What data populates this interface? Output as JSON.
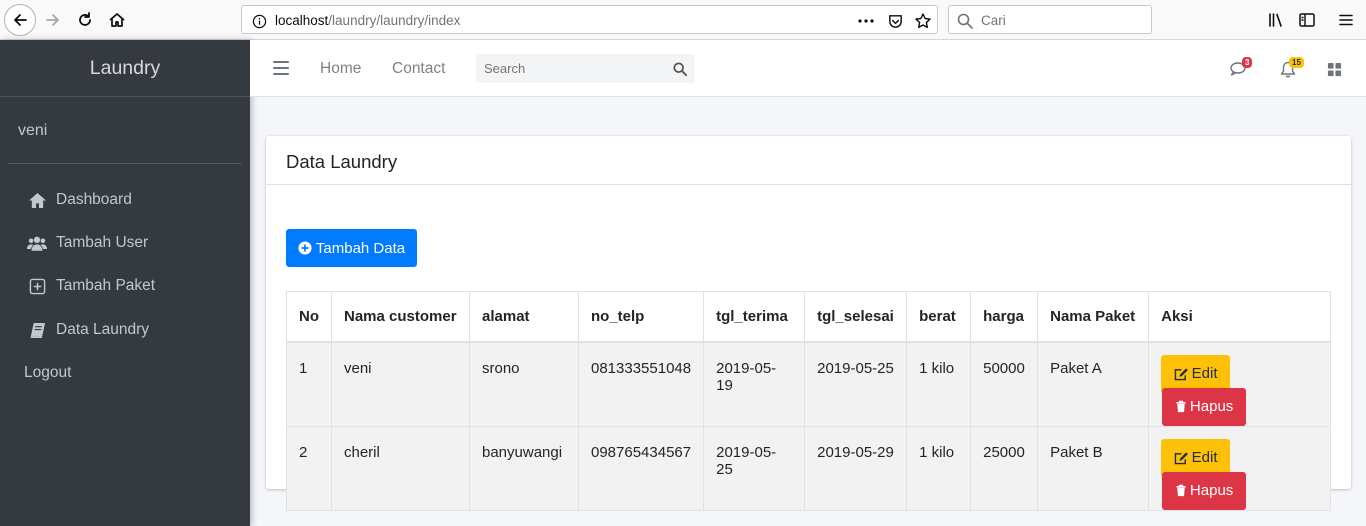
{
  "browser": {
    "url_host": "localhost",
    "url_path": "/laundry/laundry/index",
    "search_placeholder": "Cari"
  },
  "sidebar": {
    "brand": "Laundry",
    "user": "veni",
    "items": [
      {
        "label": "Dashboard",
        "icon": "home-icon"
      },
      {
        "label": "Tambah User",
        "icon": "users-icon"
      },
      {
        "label": "Tambah Paket",
        "icon": "plus-square-icon"
      },
      {
        "label": "Data Laundry",
        "icon": "book-icon"
      },
      {
        "label": "Logout"
      }
    ]
  },
  "navbar": {
    "links": [
      "Home",
      "Contact"
    ],
    "search_placeholder": "Search",
    "messages_count": "3",
    "notifications_count": "15"
  },
  "card": {
    "title": "Data Laundry",
    "add_button": "Tambah Data"
  },
  "table": {
    "headers": [
      "No",
      "Nama customer",
      "alamat",
      "no_telp",
      "tgl_terima",
      "tgl_selesai",
      "berat",
      "harga",
      "Nama Paket",
      "Aksi"
    ],
    "rows": [
      {
        "no": "1",
        "nama": "veni",
        "alamat": "srono",
        "telp": "081333551048",
        "terima": "2019-05-19",
        "selesai": "2019-05-25",
        "berat": "1 kilo",
        "harga": "50000",
        "paket": "Paket A"
      },
      {
        "no": "2",
        "nama": "cheril",
        "alamat": "banyuwangi",
        "telp": "098765434567",
        "terima": "2019-05-25",
        "selesai": "2019-05-29",
        "berat": "1 kilo",
        "harga": "25000",
        "paket": "Paket B"
      }
    ],
    "edit_label": "Edit",
    "delete_label": "Hapus"
  },
  "colors": {
    "primary": "#007bff",
    "warning": "#ffc107",
    "danger": "#dc3545",
    "sidebar": "#343a40"
  }
}
